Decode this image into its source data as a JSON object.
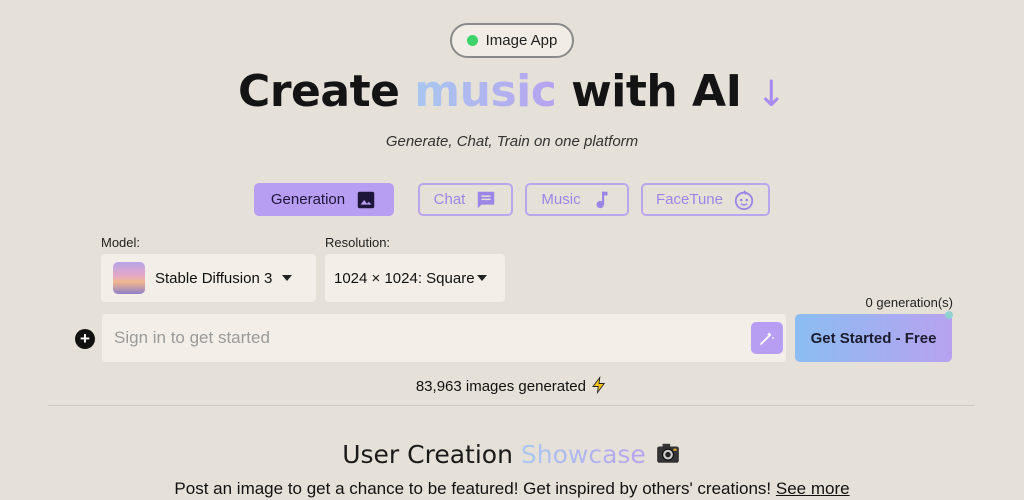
{
  "badge": {
    "label": "Image App",
    "dot_color": "#3ed36a"
  },
  "hero": {
    "title_prefix": "Create ",
    "title_accent": "music",
    "title_suffix": " with AI",
    "arrow": "↓",
    "subtitle": "Generate, Chat, Train on one platform"
  },
  "tabs": [
    {
      "label": "Generation",
      "icon": "image-icon",
      "active": true
    },
    {
      "label": "Chat",
      "icon": "chat-icon",
      "active": false
    },
    {
      "label": "Music",
      "icon": "music-note-icon",
      "active": false
    },
    {
      "label": "FaceTune",
      "icon": "face-icon",
      "active": false
    }
  ],
  "model": {
    "label": "Model:",
    "value": "Stable Diffusion 3"
  },
  "resolution": {
    "label": "Resolution:",
    "value": "1024 × 1024: Square"
  },
  "generation_count": "0 generation(s)",
  "prompt": {
    "placeholder": "Sign in to get started",
    "value": ""
  },
  "cta": {
    "label": "Get Started - Free"
  },
  "stats": {
    "images_generated": "83,963 images generated",
    "icon": "lightning-icon"
  },
  "showcase": {
    "title_prefix": "User Creation ",
    "title_accent": "Showcase",
    "icon": "camera-icon",
    "subtitle": "Post an image to get a chance to be featured! Get inspired by others' creations!",
    "link": "See more"
  },
  "colors": {
    "accent": "#b79ef3",
    "background": "#e6e1d8"
  }
}
